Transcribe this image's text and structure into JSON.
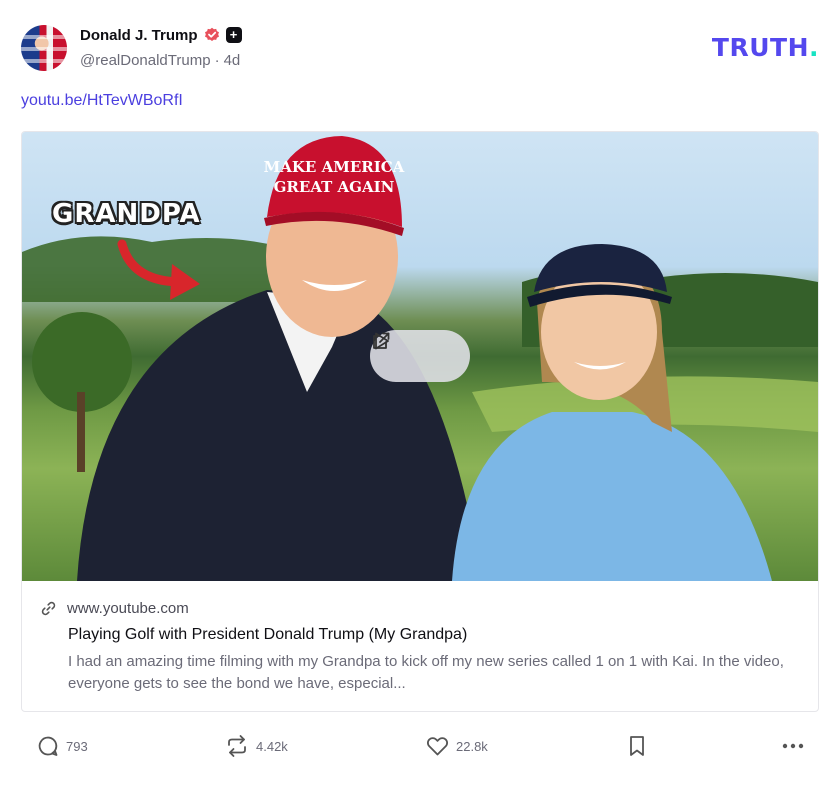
{
  "post": {
    "author": {
      "display_name": "Donald J. Trump",
      "handle": "@realDonaldTrump",
      "separator": "·",
      "age": "4d",
      "verified_color": "#e8505b"
    },
    "brand": {
      "logo_text": "TRUTH",
      "logo_dot": ".",
      "color": "#5448ee",
      "dot_color": "#17e3c2"
    },
    "link_text": "youtu.be/HtTevWBoRfI",
    "link_color": "#4b3fdf",
    "card": {
      "thumbnail_overlay_text": "GRANDPA",
      "cap_text": "MAKE AMERICA GREAT AGAIN",
      "domain": "www.youtube.com",
      "title": "Playing Golf with President Donald Trump (My Grandpa)",
      "description": "I had an amazing time filming with my Grandpa to kick off my new series called 1 on 1 with Kai. In the video, everyone gets to see the bond we have, especial..."
    },
    "actions": {
      "replies": "793",
      "retruths": "4.42k",
      "likes": "22.8k"
    },
    "icons": {
      "reply": "comment-bubble-icon",
      "retruth": "repost-arrows-icon",
      "like": "heart-icon",
      "bookmark": "bookmark-icon",
      "more": "more-dots-icon",
      "play": "play-icon",
      "open_external": "external-link-icon",
      "link": "link-chain-icon"
    }
  }
}
